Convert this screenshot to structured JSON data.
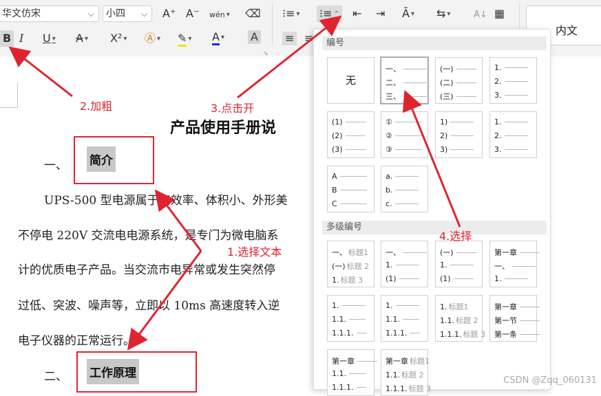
{
  "toolbar": {
    "font_name": "华文仿宋",
    "font_size": "小四",
    "bold_label": "B",
    "italic_label": "I",
    "underline_label": "U",
    "superscript_label": "X²",
    "font_color_label": "A",
    "char_shade_label": "A",
    "grow_font_label": "A⁺",
    "shrink_font_label": "A⁻",
    "phonetic_label": "wén",
    "sort_label": "A↓"
  },
  "style_gallery": {
    "body_label": "内文"
  },
  "document": {
    "title": "产品使用手册说",
    "heading1_num": "一、",
    "heading1_text": "简介",
    "line1": "UPS-500 型电源属于高效率、体积小、外形美",
    "line2": "不停电 220V 交流电电源系统，是专门为微电脑系",
    "line3": "计的优质电子产品。当交流市电异常或发生突然停",
    "line4": "过低、突波、噪声等，立即以 10ms 高速度转入逆",
    "line5": "电子仪器的正常运行。",
    "heading2_num": "二、",
    "heading2_text": "工作原理"
  },
  "numbering_panel": {
    "section1_title": "编号",
    "section2_title": "多级编号",
    "none_label": "无",
    "single": [
      [
        "一、",
        "二、",
        "三、"
      ],
      [
        "(一)",
        "(二)",
        "(三)"
      ],
      [
        "1.",
        "2.",
        "3."
      ],
      [
        "(1)",
        "(2)",
        "(3)"
      ],
      [
        "①",
        "②",
        "③"
      ],
      [
        "1)",
        "2)",
        "3)"
      ],
      [
        "1.",
        "2.",
        "3."
      ],
      [
        "A",
        "B",
        "C"
      ],
      [
        "a.",
        "b.",
        "c."
      ]
    ],
    "multi": [
      [
        [
          "一、",
          "标题1"
        ],
        [
          "(一)",
          "标题 2"
        ],
        [
          "1.",
          "标题 3"
        ]
      ],
      [
        [
          "一、",
          ""
        ],
        [
          "1.",
          ""
        ],
        [
          "(1)",
          ""
        ]
      ],
      [
        [
          "(一)",
          ""
        ],
        [
          "1.",
          ""
        ],
        [
          "(1)",
          ""
        ]
      ],
      [
        [
          "第一章",
          ""
        ],
        [
          "一、",
          ""
        ],
        [
          "1.",
          ""
        ]
      ],
      [
        [
          "1.",
          ""
        ],
        [
          "1.1.",
          ""
        ],
        [
          "1.1.1.",
          ""
        ]
      ],
      [
        [
          "1.",
          ""
        ],
        [
          "1.1.",
          ""
        ],
        [
          "1.1.1.",
          ""
        ]
      ],
      [
        [
          "1.",
          "标题1"
        ],
        [
          "1.1.",
          "标题 2"
        ],
        [
          "1.1.1.",
          "标题 3"
        ]
      ],
      [
        [
          "第一章",
          ""
        ],
        [
          "第一节",
          ""
        ],
        [
          "第一条",
          ""
        ]
      ],
      [
        [
          "第一章",
          ""
        ],
        [
          "1.1.",
          ""
        ],
        [
          "1.1.1.",
          ""
        ]
      ],
      [
        [
          "第一章",
          "标题1"
        ],
        [
          "1.1.",
          "标题 2"
        ],
        [
          "1.1.1.",
          "标题 3"
        ]
      ]
    ]
  },
  "annotations": {
    "step1": "1.选择文本",
    "step2": "2.加粗",
    "step3": "3.点击开",
    "step4": "4.选择"
  },
  "watermark": "CSDN @Zqq_060131",
  "colors": {
    "annotation_red": "#e0242f",
    "highlight_gray": "#c8c8c8"
  }
}
